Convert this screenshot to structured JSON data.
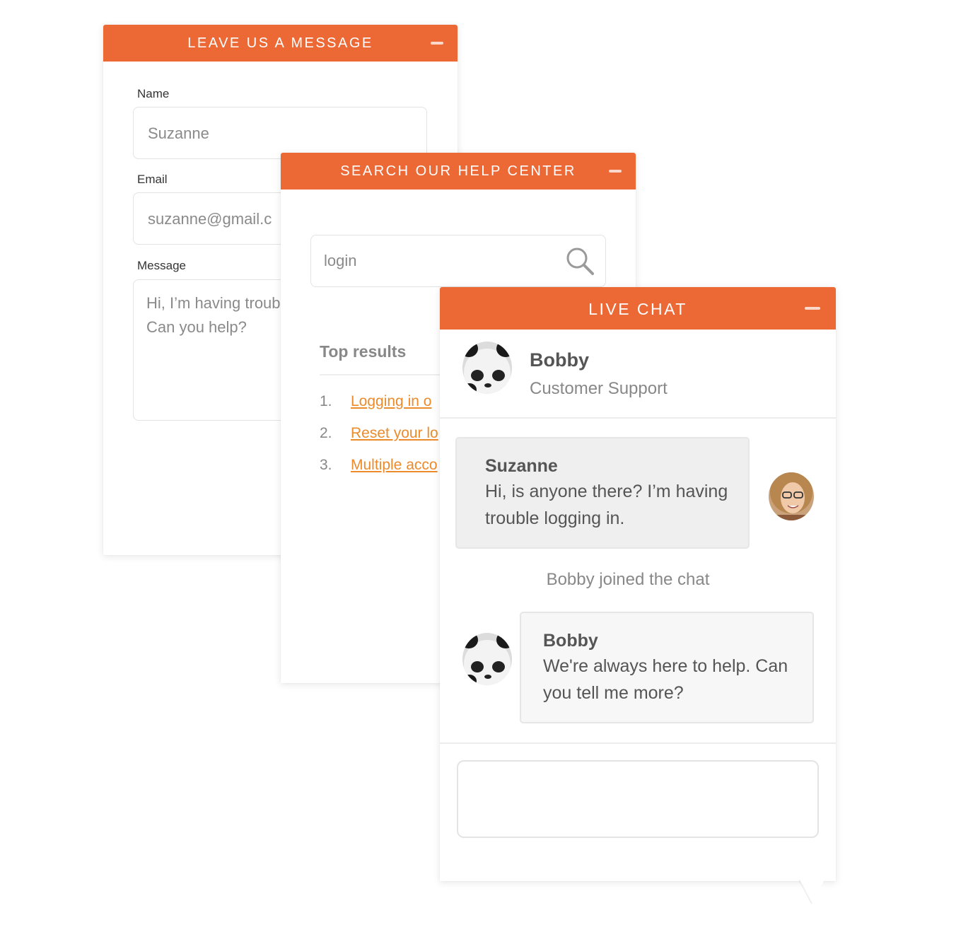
{
  "leave_message": {
    "title": "LEAVE US A MESSAGE",
    "name_label": "Name",
    "name_value": "Suzanne",
    "email_label": "Email",
    "email_value": "suzanne@gmail.c",
    "message_label": "Message",
    "message_value": "Hi, I’m having troub\nCan you help?"
  },
  "help_center": {
    "title": "SEARCH OUR HELP CENTER",
    "search_value": "login",
    "top_results_title": "Top results",
    "results": [
      {
        "number": "1.",
        "label": "Logging in o"
      },
      {
        "number": "2.",
        "label": "Reset your lo"
      },
      {
        "number": "3.",
        "label": "Multiple acco"
      }
    ]
  },
  "live_chat": {
    "title": "LIVE CHAT",
    "agent": {
      "name": "Bobby",
      "role": "Customer Support"
    },
    "messages": [
      {
        "sender": "Suzanne",
        "text": "Hi, is anyone there? I’m having trouble logging in."
      },
      {
        "sender": "Bobby",
        "text": "We're always here to help. Can you tell me more?"
      }
    ],
    "system_message": "Bobby joined the chat"
  },
  "colors": {
    "accent": "#ec6936",
    "link": "#ec8b2c"
  }
}
